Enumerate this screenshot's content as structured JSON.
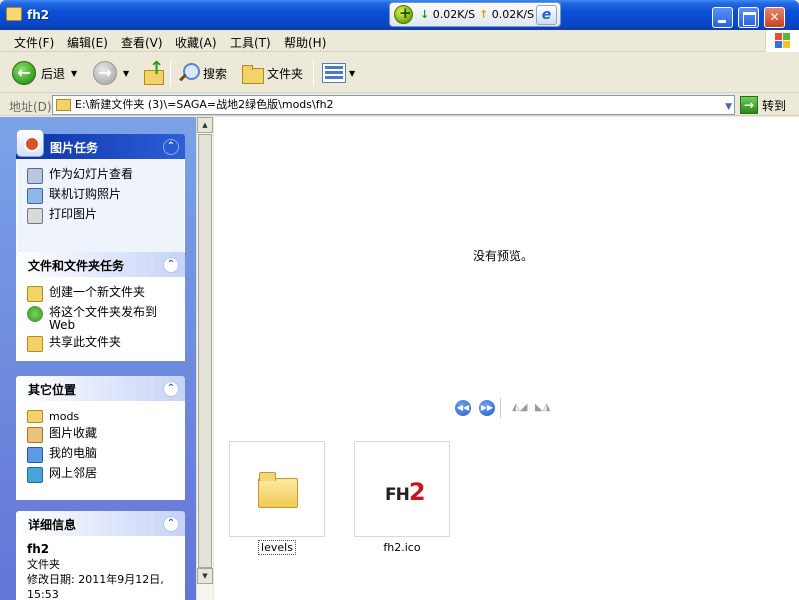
{
  "window": {
    "title": "fh2"
  },
  "speed_widget": {
    "download": "0.02K/S",
    "upload": "0.02K/S"
  },
  "menu": {
    "items": [
      "文件(F)",
      "编辑(E)",
      "查看(V)",
      "收藏(A)",
      "工具(T)",
      "帮助(H)"
    ]
  },
  "toolbar": {
    "back_label": "后退",
    "search_label": "搜索",
    "folders_label": "文件夹"
  },
  "address": {
    "label": "地址(D)",
    "value": "E:\\新建文件夹 (3)\\=SAGA=战地2绿色版\\mods\\fh2",
    "go_label": "转到"
  },
  "taskpane": {
    "picture_tasks": {
      "title": "图片任务",
      "items": [
        "作为幻灯片查看",
        "联机订购照片",
        "打印图片"
      ]
    },
    "file_tasks": {
      "title": "文件和文件夹任务",
      "items": [
        "创建一个新文件夹",
        "将这个文件夹发布到 Web",
        "共享此文件夹"
      ]
    },
    "other_places": {
      "title": "其它位置",
      "items": [
        "mods",
        "图片收藏",
        "我的电脑",
        "网上邻居"
      ]
    },
    "details": {
      "title": "详细信息",
      "name": "fh2",
      "type": "文件夹",
      "modified": "修改日期: 2011年9月12日, 15:53"
    }
  },
  "preview": {
    "message": "没有预览。"
  },
  "files": [
    {
      "name": "levels",
      "type": "folder"
    },
    {
      "name": "fh2.ico",
      "type": "icon",
      "logo_text": "FH",
      "logo_num": "2"
    }
  ],
  "colors": {
    "titlebar": "#0a4fd6",
    "taskpane_bg": "#7ba2e7",
    "panel_head_text": "#215dc6"
  }
}
